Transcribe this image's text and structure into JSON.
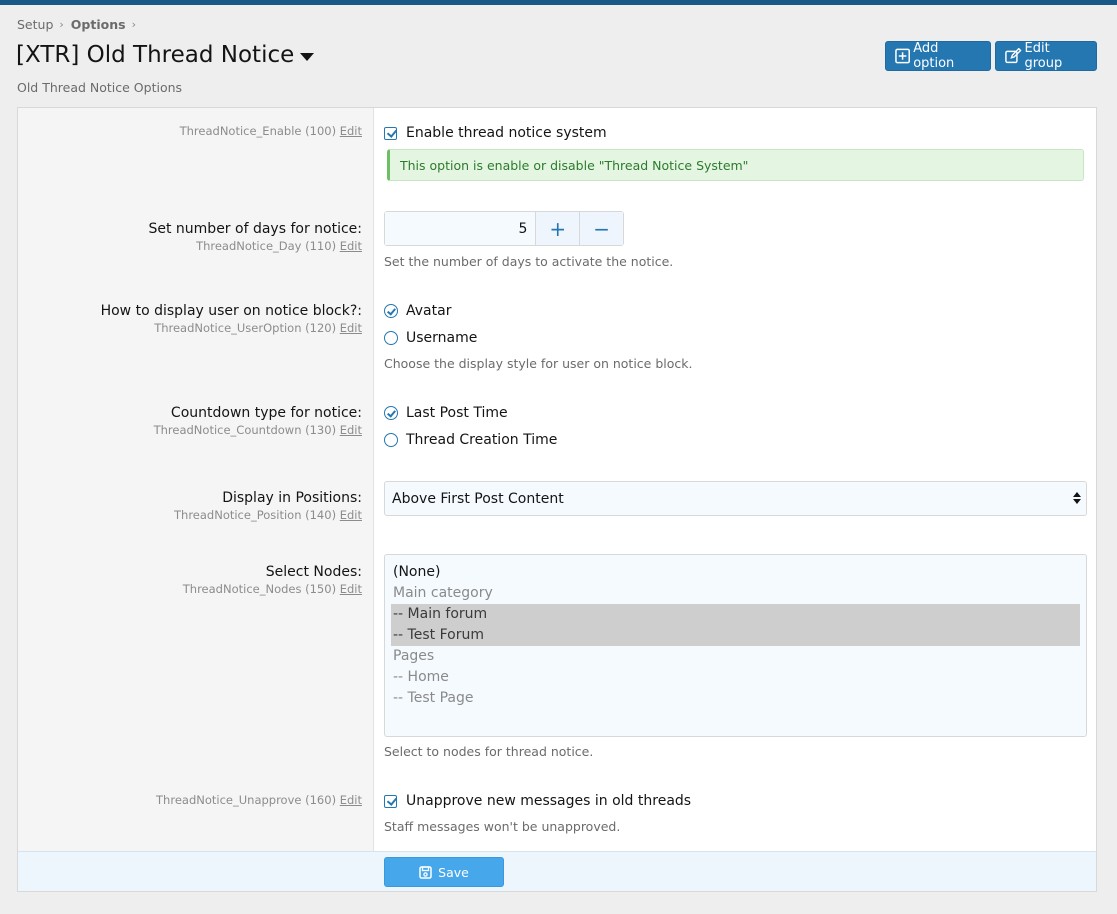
{
  "breadcrumb": {
    "setup": "Setup",
    "options": "Options"
  },
  "header": {
    "title": "[XTR] Old Thread Notice",
    "description": "Old Thread Notice Options",
    "add_option": "Add option",
    "edit_group": "Edit group"
  },
  "options": {
    "enable": {
      "hint": "ThreadNotice_Enable (100)",
      "edit": "Edit",
      "checkbox_label": "Enable thread notice system",
      "notice": "This option is enable or disable \"Thread Notice System\""
    },
    "days": {
      "label": "Set number of days for notice:",
      "hint": "ThreadNotice_Day (110)",
      "edit": "Edit",
      "value": "5",
      "plus": "+",
      "minus": "−",
      "explain": "Set the number of days to activate the notice."
    },
    "user_option": {
      "label": "How to display user on notice block?:",
      "hint": "ThreadNotice_UserOption (120)",
      "edit": "Edit",
      "choices": [
        "Avatar",
        "Username"
      ],
      "explain": "Choose the display style for user on notice block."
    },
    "countdown": {
      "label": "Countdown type for notice:",
      "hint": "ThreadNotice_Countdown (130)",
      "edit": "Edit",
      "choices": [
        "Last Post Time",
        "Thread Creation Time"
      ]
    },
    "position": {
      "label": "Display in Positions:",
      "hint": "ThreadNotice_Position (140)",
      "edit": "Edit",
      "selected": "Above First Post Content"
    },
    "nodes": {
      "label": "Select Nodes:",
      "hint": "ThreadNotice_Nodes (150)",
      "edit": "Edit",
      "items": [
        "(None)",
        "Main category",
        "-- Main forum",
        "-- Test Forum",
        "Pages",
        "-- Home",
        "-- Test Page"
      ],
      "explain": "Select to nodes for thread notice."
    },
    "unapprove": {
      "hint": "ThreadNotice_Unapprove (160)",
      "edit": "Edit",
      "checkbox_label": "Unapprove new messages in old threads",
      "explain": "Staff messages won't be unapproved."
    }
  },
  "footer": {
    "save": "Save"
  },
  "colors": {
    "topbar": "#185886",
    "primary_button": "#2577b1",
    "save_button": "#47a7eb",
    "notice_bg": "#e4f6e2"
  }
}
